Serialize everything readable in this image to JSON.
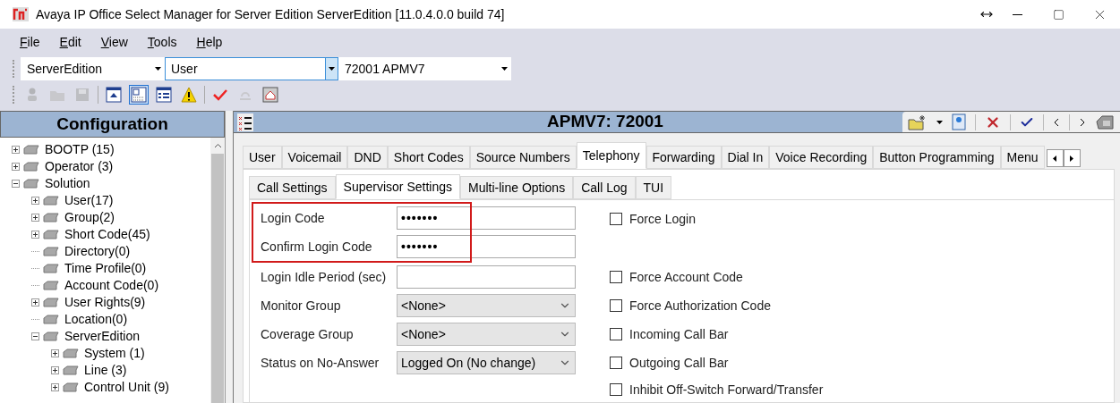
{
  "window": {
    "title": "Avaya IP Office Select Manager for Server Edition ServerEdition [11.0.4.0.0 build 74]"
  },
  "menu": [
    "File",
    "Edit",
    "View",
    "Tools",
    "Help"
  ],
  "selectors": [
    {
      "value": "ServerEdition",
      "focused": false
    },
    {
      "value": "User",
      "focused": true
    },
    {
      "value": "72001 APMV7",
      "focused": false
    }
  ],
  "toolbar": [
    {
      "disabled": true,
      "selected": false
    },
    {
      "disabled": true,
      "selected": false
    },
    {
      "disabled": true,
      "selected": false
    },
    {
      "disabled": false,
      "selected": false
    },
    {
      "disabled": false,
      "selected": true
    },
    {
      "disabled": false,
      "selected": false
    },
    {
      "disabled": false,
      "selected": false
    },
    {
      "disabled": false,
      "selected": false
    },
    {
      "disabled": true,
      "selected": false
    },
    {
      "disabled": false,
      "selected": false
    }
  ],
  "sidebar": {
    "title": "Configuration",
    "items": [
      {
        "label": "BOOTP (15)",
        "expandable": true,
        "expanded": false
      },
      {
        "label": "Operator (3)",
        "expandable": true,
        "expanded": false
      },
      {
        "label": "Solution",
        "expandable": true,
        "expanded": true,
        "children": [
          {
            "label": "User(17)",
            "expandable": true,
            "expanded": false
          },
          {
            "label": "Group(2)",
            "expandable": true,
            "expanded": false
          },
          {
            "label": "Short Code(45)",
            "expandable": true,
            "expanded": false
          },
          {
            "label": "Directory(0)",
            "expandable": false
          },
          {
            "label": "Time Profile(0)",
            "expandable": false
          },
          {
            "label": "Account Code(0)",
            "expandable": false
          },
          {
            "label": "User Rights(9)",
            "expandable": true,
            "expanded": false
          },
          {
            "label": "Location(0)",
            "expandable": false
          },
          {
            "label": "ServerEdition",
            "expandable": true,
            "expanded": true,
            "children": [
              {
                "label": "System (1)",
                "expandable": true,
                "expanded": false
              },
              {
                "label": "Line (3)",
                "expandable": true,
                "expanded": false
              },
              {
                "label": "Control Unit (9)",
                "expandable": true,
                "expanded": false
              }
            ]
          }
        ]
      }
    ]
  },
  "detail": {
    "title": "APMV7: 72001",
    "tabs": [
      {
        "label": "User",
        "selected": false
      },
      {
        "label": "Voicemail",
        "selected": false
      },
      {
        "label": "DND",
        "selected": false
      },
      {
        "label": "Short Codes",
        "selected": false
      },
      {
        "label": "Source Numbers",
        "selected": false
      },
      {
        "label": "Telephony",
        "selected": true
      },
      {
        "label": "Forwarding",
        "selected": false
      },
      {
        "label": "Dial In",
        "selected": false
      },
      {
        "label": "Voice Recording",
        "selected": false
      },
      {
        "label": "Button Programming",
        "selected": false
      },
      {
        "label": "Menu",
        "selected": false
      }
    ],
    "subtabs": [
      {
        "label": "Call Settings",
        "selected": false
      },
      {
        "label": "Supervisor Settings",
        "selected": true
      },
      {
        "label": "Multi-line Options",
        "selected": false
      },
      {
        "label": "Call Log",
        "selected": false
      },
      {
        "label": "TUI",
        "selected": false
      }
    ],
    "field_groups": [
      {
        "highlighted": true,
        "fields": [
          {
            "label": "Login Code",
            "kind": "password",
            "value": "•••••••"
          },
          {
            "label": "Confirm Login Code",
            "kind": "password",
            "value": "•••••••"
          }
        ]
      },
      {
        "highlighted": false,
        "fields": [
          {
            "label": "Login Idle Period (sec)",
            "kind": "text"
          },
          {
            "label": "Monitor Group",
            "kind": "select",
            "value": "<None>"
          },
          {
            "label": "Coverage Group",
            "kind": "select",
            "value": "<None>"
          },
          {
            "label": "Status on No-Answer",
            "kind": "select",
            "value": "Logged On (No change)"
          }
        ]
      }
    ],
    "checkboxes": [
      {
        "label": "Force Login",
        "checked": false
      },
      {
        "label": "Force Account Code",
        "checked": false
      },
      {
        "label": "Force Authorization Code",
        "checked": false
      },
      {
        "label": "Incoming Call Bar",
        "checked": false
      },
      {
        "label": "Outgoing Call Bar",
        "checked": false
      },
      {
        "label": "Inhibit Off-Switch Forward/Transfer",
        "checked": false
      }
    ]
  }
}
